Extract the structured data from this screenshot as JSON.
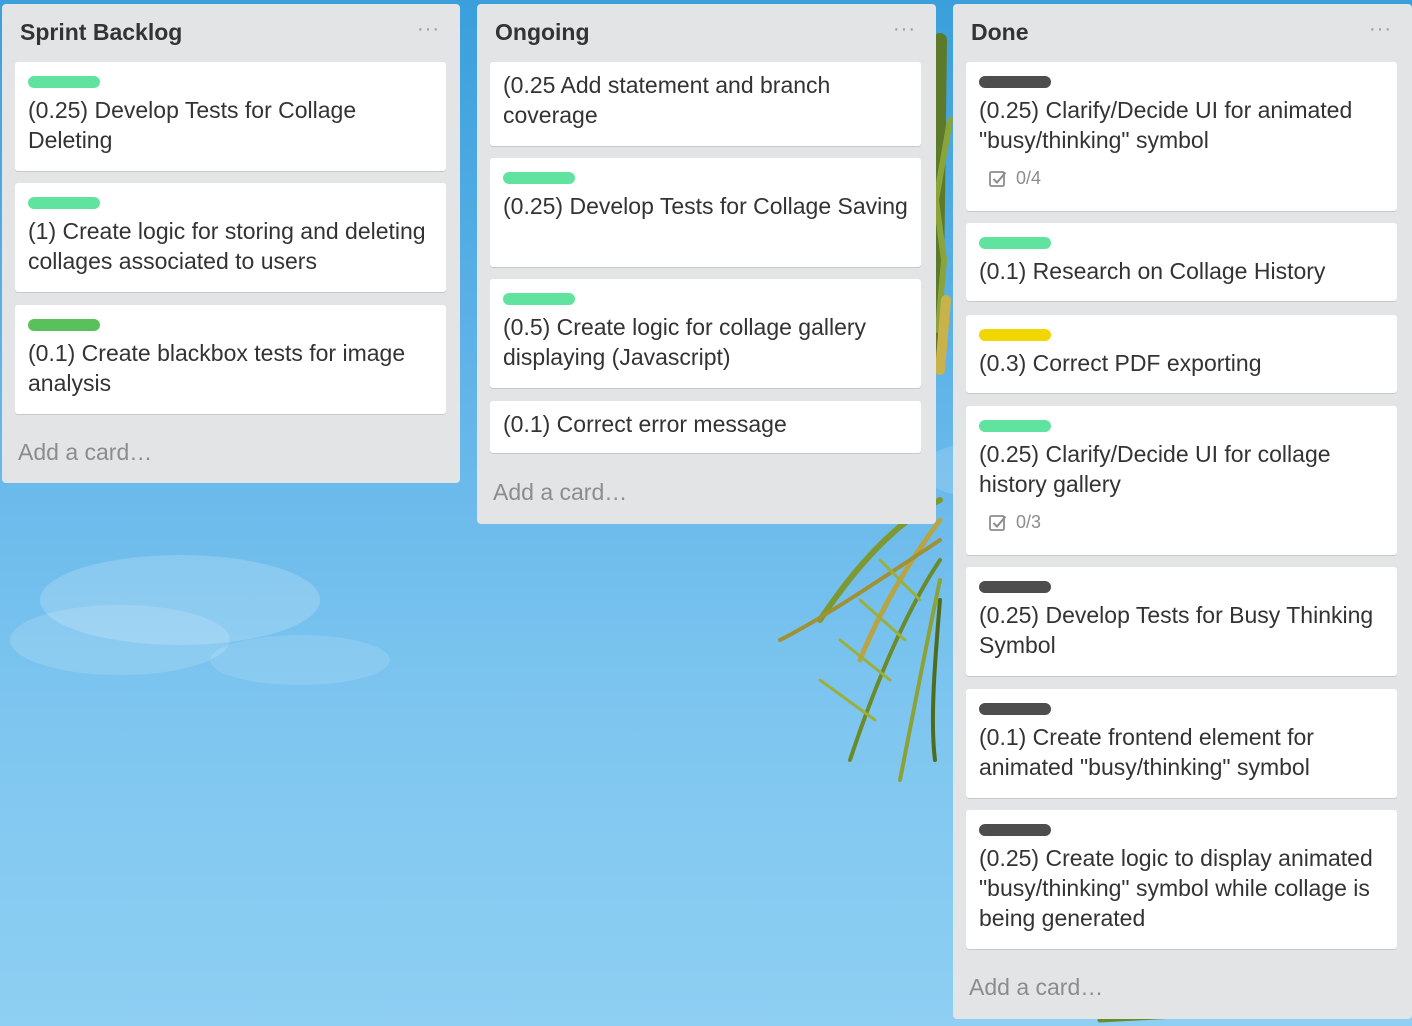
{
  "colors": {
    "label_green": "#61e3a0",
    "label_dark_green": "#5ac15a",
    "label_black": "#4d4d4d",
    "label_yellow": "#f2d600",
    "list_bg": "#e2e4e6",
    "card_bg": "#ffffff"
  },
  "lists": [
    {
      "title": "Sprint Backlog",
      "menu": "···",
      "add_card": "Add a card…",
      "cards": [
        {
          "label_color": "green",
          "text": "(0.25) Develop Tests for Collage Deleting"
        },
        {
          "label_color": "green",
          "text": "(1) Create logic for storing and deleting collages associated to users"
        },
        {
          "label_color": "dark-green",
          "text": "(0.1) Create blackbox tests for image analysis"
        }
      ]
    },
    {
      "title": "Ongoing",
      "menu": "···",
      "add_card": "Add a card…",
      "cards": [
        {
          "label_color": "",
          "text": "(0.25 Add statement and branch coverage"
        },
        {
          "label_color": "green",
          "text": "(0.25) Develop Tests for Collage Saving"
        },
        {
          "label_color": "green",
          "text": "(0.5) Create logic for collage gallery displaying (Javascript)"
        },
        {
          "label_color": "",
          "text": "(0.1) Correct error message"
        }
      ]
    },
    {
      "title": "Done",
      "menu": "···",
      "add_card": "Add a card…",
      "cards": [
        {
          "label_color": "black",
          "text": "(0.25) Clarify/Decide UI for animated \"busy/thinking\" symbol",
          "checklist": "0/4",
          "checklist_icon": "checklist-icon"
        },
        {
          "label_color": "green",
          "text": "(0.1) Research on Collage History"
        },
        {
          "label_color": "yellow",
          "text": "(0.3) Correct PDF exporting"
        },
        {
          "label_color": "green",
          "text": "(0.25) Clarify/Decide UI for collage history gallery",
          "checklist": "0/3",
          "checklist_icon": "checklist-icon"
        },
        {
          "label_color": "black",
          "text": "(0.25) Develop Tests for Busy Thinking Symbol"
        },
        {
          "label_color": "black",
          "text": "(0.1) Create frontend element for animated \"busy/thinking\" symbol"
        },
        {
          "label_color": "black",
          "text": "(0.25) Create logic to display animated \"busy/thinking\" symbol while collage is being generated"
        }
      ]
    }
  ]
}
